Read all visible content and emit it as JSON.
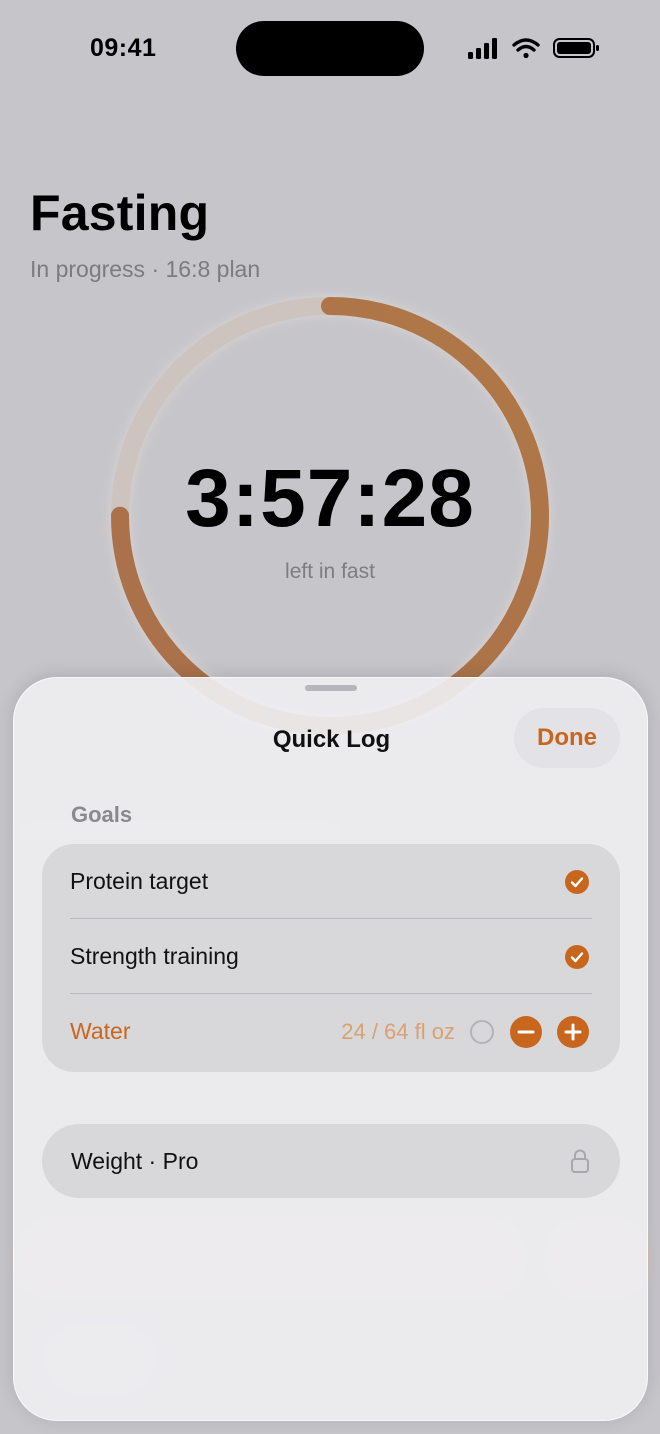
{
  "status_bar": {
    "time": "09:41"
  },
  "header": {
    "title": "Fasting",
    "subtitle": "In progress · 16:8 plan"
  },
  "timer": {
    "value": "3:57:28",
    "caption": "left in fast",
    "progress": 0.75
  },
  "colors": {
    "accent": "#c8661e",
    "sheet": "#eeeef1",
    "card": "#d2d2d6",
    "background": "#c6c5ca"
  },
  "sheet": {
    "title": "Quick Log",
    "done_label": "Done",
    "section_label": "Goals",
    "goals": [
      {
        "label": "Protein target",
        "checked": true
      },
      {
        "label": "Strength training",
        "checked": true
      },
      {
        "label": "Water",
        "value": "24 / 64 fl oz",
        "checked": false
      }
    ],
    "weight_label": "Weight · Pro"
  },
  "icons": [
    "signal-icon",
    "wifi-icon",
    "battery-icon",
    "check-icon",
    "minus-icon",
    "plus-icon",
    "lock-icon"
  ]
}
